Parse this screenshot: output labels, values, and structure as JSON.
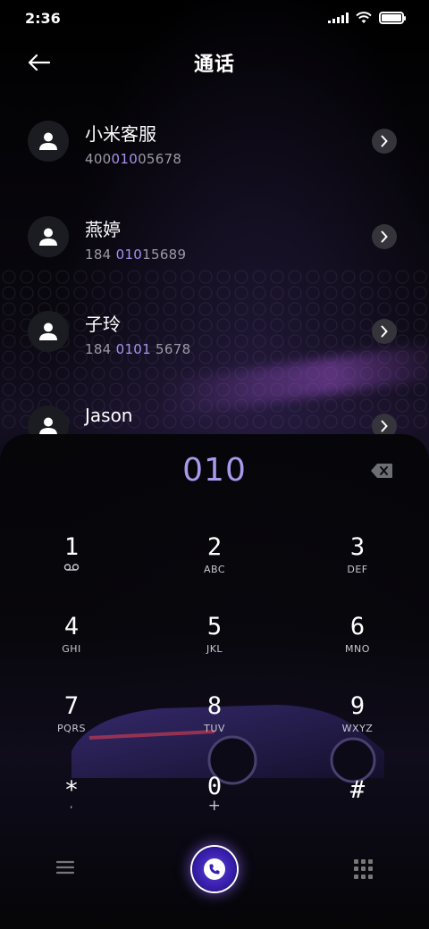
{
  "status_bar": {
    "time": "2:36",
    "icons": [
      "signal-icon",
      "wifi-icon",
      "battery-icon"
    ],
    "battery_level": 1.0
  },
  "header": {
    "back_icon": "back-arrow-icon",
    "title": "通话"
  },
  "contacts": [
    {
      "name": "小米客服",
      "number_parts": [
        "400",
        "010",
        "05678"
      ]
    },
    {
      "name": "燕婷",
      "number_parts": [
        "184 ",
        "010",
        "15689"
      ]
    },
    {
      "name": "子玲",
      "number_parts": [
        "184 ",
        "0101",
        " 5678"
      ]
    },
    {
      "name": "Jason",
      "number_parts": [
        "",
        "",
        ""
      ]
    }
  ],
  "dialpad": {
    "input": "010",
    "keys": [
      {
        "digit": "1",
        "letters": "ᴏ_ᴏ"
      },
      {
        "digit": "2",
        "letters": "ABC"
      },
      {
        "digit": "3",
        "letters": "DEF"
      },
      {
        "digit": "4",
        "letters": "GHI"
      },
      {
        "digit": "5",
        "letters": "JKL"
      },
      {
        "digit": "6",
        "letters": "MNO"
      },
      {
        "digit": "7",
        "letters": "PQRS"
      },
      {
        "digit": "8",
        "letters": "TUV"
      },
      {
        "digit": "9",
        "letters": "WXYZ"
      },
      {
        "digit": "*",
        "letters": ","
      },
      {
        "digit": "0",
        "letters": "+"
      },
      {
        "digit": "#",
        "letters": ""
      }
    ]
  },
  "colors": {
    "accent": "#a899ec",
    "highlight": "#a792ee",
    "background": "#000000"
  }
}
